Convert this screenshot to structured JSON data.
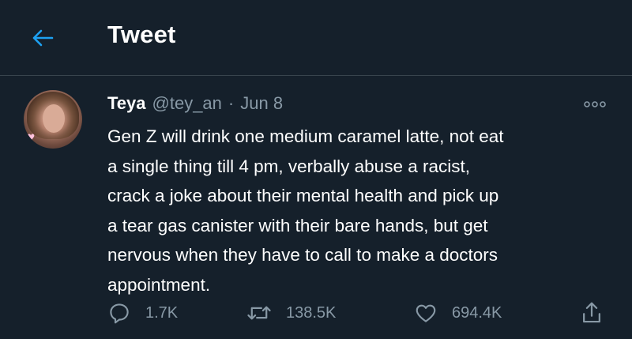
{
  "header": {
    "title": "Tweet",
    "back_icon": "arrow-left-icon"
  },
  "tweet": {
    "display_name": "Teya",
    "handle": "@tey_an",
    "separator": "·",
    "date": "Jun 8",
    "text": "Gen Z will drink one medium caramel latte, not eat\na single thing till 4 pm, verbally abuse a racist,\ncrack a joke about their mental health and pick up\na tear gas canister with their bare hands, but get\nnervous when they have to call to make a doctors\nappointment."
  },
  "actions": {
    "reply": {
      "icon": "reply-icon",
      "count": "1.7K"
    },
    "retweet": {
      "icon": "retweet-icon",
      "count": "138.5K"
    },
    "like": {
      "icon": "heart-icon",
      "count": "694.4K"
    },
    "share": {
      "icon": "share-icon"
    }
  },
  "colors": {
    "background": "#15202b",
    "accent": "#1da1f2",
    "secondary_text": "#8899a6",
    "divider": "#38444d"
  }
}
